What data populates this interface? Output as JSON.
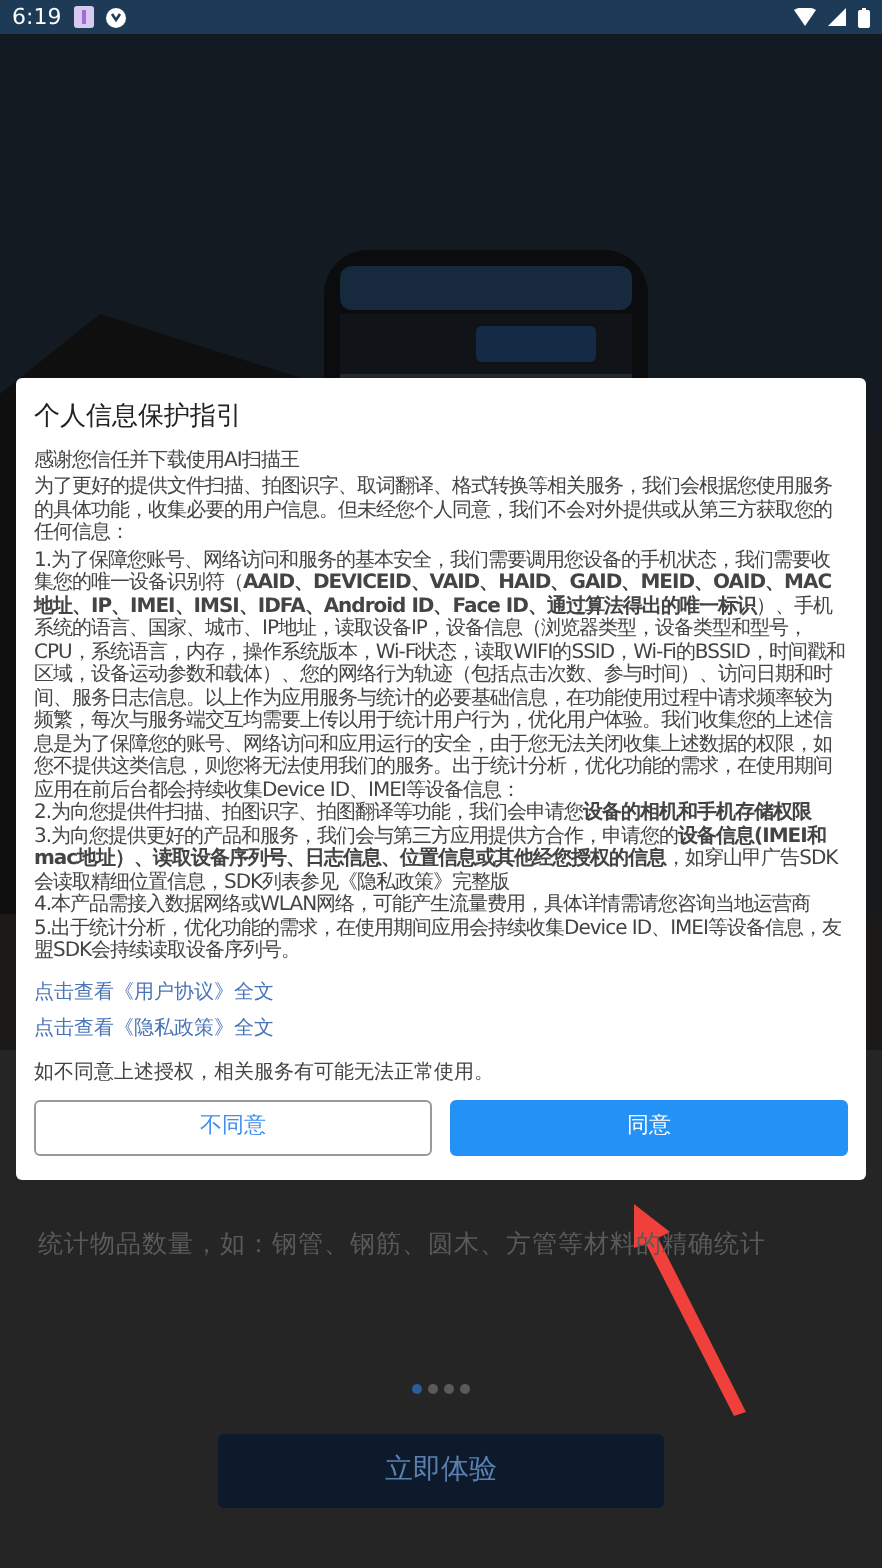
{
  "status_bar": {
    "time": "6:19"
  },
  "page": {
    "description": "统计物品数量，如：钢管、钢筋、圆木、方管等材料的精确统计",
    "dots": [
      {
        "selected": true
      },
      {
        "selected": false
      },
      {
        "selected": false
      },
      {
        "selected": false
      }
    ],
    "start_button": "立即体验"
  },
  "dialog": {
    "title": "个人信息保护指引",
    "greeting": "感谢您信任并下载使用AI扫描王",
    "intro": "为了更好的提供文件扫描、拍图识字、取词翻译、格式转换等相关服务，我们会根据您使用服务的具体功能，收集必要的用户信息。但未经您个人同意，我们不会对外提供或从第三方获取您的任何信息：",
    "items": [
      "1.为了保障您账号、网络访问和服务的基本安全，我们需要调用您设备的手机状态，我们需要收集您的唯一设备识别符（**AAID、DEVICEID、VAID、HAID、GAID、MEID、OAID、MAC地址、IP、IMEI、IMSI、IDFA、Android ID、Face ID、通过算法得出的唯一标识**）、手机系统的语言、国家、城市、IP地址，读取设备IP，设备信息（浏览器类型，设备类型和型号，CPU，系统语言，内存，操作系统版本，Wi-Fi状态，读取WIFI的SSID，Wi-Fi的BSSID，时间戳和区域，设备运动参数和载体）、您的网络行为轨迹（包括点击次数、参与时间）、访问日期和时间、服务日志信息。以上作为应用服务与统计的必要基础信息，在功能使用过程中请求频率较为频繁，每次与服务端交互均需要上传以用于统计用户行为，优化用户体验。我们收集您的上述信息是为了保障您的账号、网络访问和应用运行的安全，由于您无法关闭收集上述数据的权限，如您不提供这类信息，则您将无法使用我们的服务。出于统计分析，优化功能的需求，在使用期间应用在前后台都会持续收集Device ID、IMEI等设备信息：",
      "2.为向您提供件扫描、拍图识字、拍图翻译等功能，我们会申请您**设备的相机和手机存储权限**",
      "3.为向您提供更好的产品和服务，我们会与第三方应用提供方合作，申请您的**设备信息(IMEI和mac地址）、读取设备序列号、日志信息、位置信息或其他经您授权的信息**，如穿山甲广告SDK会读取精细位置信息，SDK列表参见《隐私政策》完整版",
      "4.本产品需接入数据网络或WLAN网络，可能产生流量费用，具体详情需请您咨询当地运营商",
      "5.出于统计分析，优化功能的需求，在使用期间应用会持续收集Device ID、IMEI等设备信息，友盟SDK会持续读取设备序列号。"
    ],
    "links": [
      "点击查看《用户协议》全文",
      "点击查看《隐私政策》全文"
    ],
    "notice": "如不同意上述授权，相关服务有可能无法正常使用。",
    "buttons": [
      {
        "label": "不同意",
        "kind": "secondary"
      },
      {
        "label": "同意",
        "kind": "primary"
      }
    ]
  }
}
